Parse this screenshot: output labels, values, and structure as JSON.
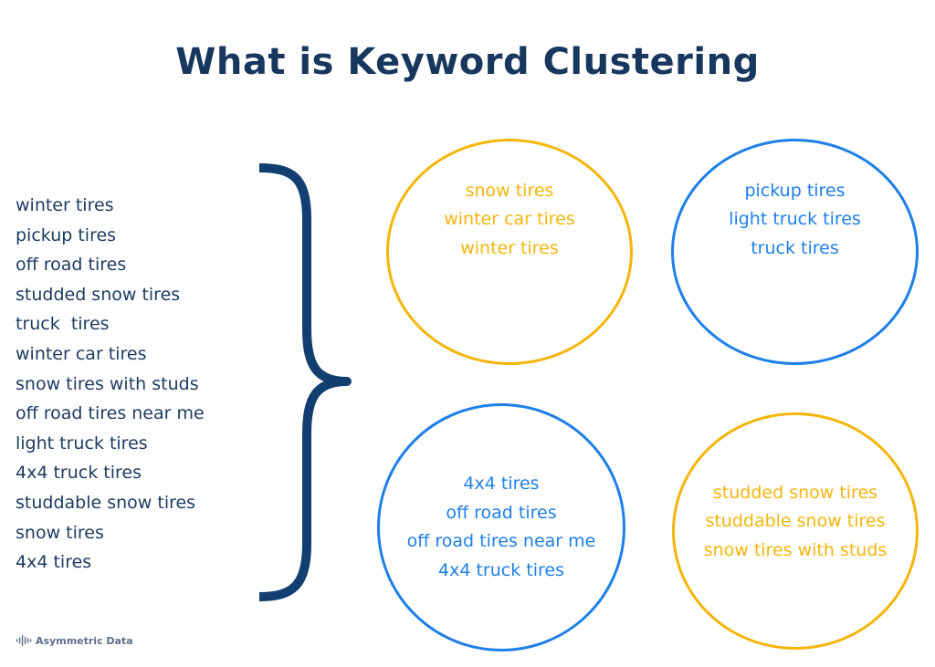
{
  "title": "What is Keyword Clustering",
  "colors": {
    "title": "#17375e",
    "list_text": "#1c3a5f",
    "brace": "#123f70",
    "yellow": "#f5b50b",
    "blue": "#1e7fe8",
    "footer": "#5d6f8a"
  },
  "keywords": [
    "winter tires",
    "pickup tires",
    "off road tires",
    "studded snow tires",
    "truck  tires",
    "winter car tires",
    "snow tires with studs",
    "off road tires near me",
    "light truck tires",
    "4x4 truck tires",
    "studdable snow tires",
    "snow tires",
    "4x4 tires"
  ],
  "clusters": [
    {
      "color": "yellow",
      "keywords": [
        "snow tires",
        "winter car tires",
        "winter tires"
      ]
    },
    {
      "color": "blue",
      "keywords": [
        "pickup tires",
        "light truck tires",
        "truck tires"
      ]
    },
    {
      "color": "blue",
      "keywords": [
        "4x4 tires",
        "off road tires",
        "off road tires near me",
        "4x4 truck tires"
      ]
    },
    {
      "color": "yellow",
      "keywords": [
        "studded snow tires",
        "studdable snow tires",
        "snow tires with studs"
      ]
    }
  ],
  "footer": {
    "icon": "waveform-logo-icon",
    "brand": "Asymmetric Data"
  }
}
